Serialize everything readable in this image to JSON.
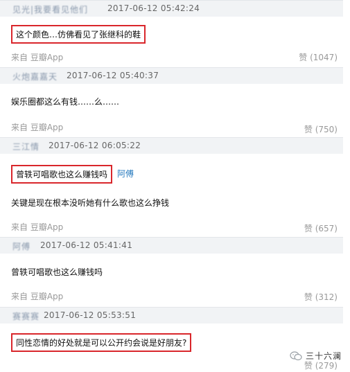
{
  "comments": [
    {
      "user": "见光|我要看见他们",
      "time": "2017-06-12 05:42:24",
      "content": "这个颜色…仿佛看见了张继科的鞋",
      "source": "来自 豆瓣App",
      "likes": "赞 (1047)"
    },
    {
      "user": "火炮嘉嘉天",
      "time": "2017-06-12 05:40:37",
      "content": "娱乐圈都这么有钱……么……",
      "source": "来自 豆瓣App",
      "likes": "赞 (750)"
    },
    {
      "user": "三江情",
      "time": "2017-06-12 06:05:22",
      "content": "曾轶可唱歌也这么赚钱吗",
      "reply_to": "阿傅",
      "content2": "关键是现在根本没听她有什么歌也这么挣钱",
      "source": "来自 豆瓣App",
      "likes": "赞 (657)"
    },
    {
      "user": "阿傅",
      "time": "2017-06-12 05:41:41",
      "content": "曾轶可唱歌也这么赚钱吗",
      "source": "来自 豆瓣App",
      "likes": "赞 (312)"
    },
    {
      "user": "赛赛赛",
      "time": "2017-06-12 05:53:51",
      "content": "同性恋情的好处就是可以公开约会说是好朋友?",
      "likes": "赞 (279)"
    }
  ],
  "watermark": {
    "text": "三十六澜"
  }
}
